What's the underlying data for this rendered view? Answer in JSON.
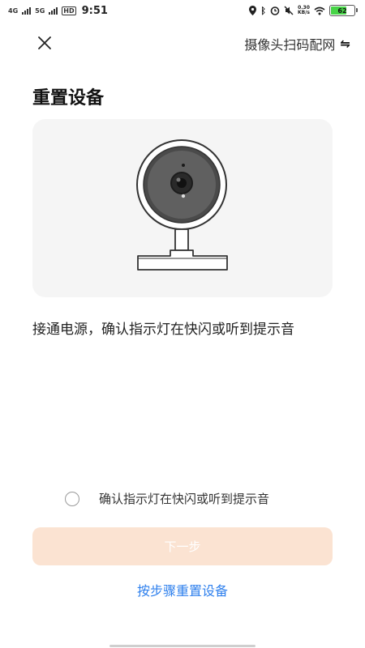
{
  "status_bar": {
    "network_1": "4G",
    "network_2": "5G",
    "hd_label": "HD",
    "time": "9:51",
    "speed_value": "0.30",
    "speed_unit": "KB/s",
    "battery_level": "62",
    "battery_color": "#47d447"
  },
  "header": {
    "close_icon": "close-icon",
    "switch_label": "摄像头扫码配网",
    "switch_icon": "⇋"
  },
  "page": {
    "title": "重置设备",
    "instruction": "接通电源，确认指示灯在快闪或听到提示音"
  },
  "confirm": {
    "label": "确认指示灯在快闪或听到提示音",
    "checked": false
  },
  "actions": {
    "next_label": "下一步",
    "next_bg_color": "#fbe3d2",
    "steps_link": "按步骤重置设备",
    "link_color": "#2f80ed"
  }
}
